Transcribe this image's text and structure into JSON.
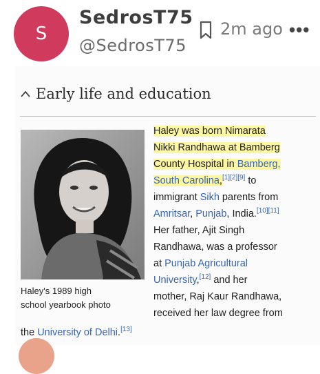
{
  "post": {
    "avatar_letter": "S",
    "username": "SedrosT75",
    "handle": "@SedrosT75",
    "time_ago": "2m ago",
    "more_label": "•••"
  },
  "colors": {
    "avatar": "#d03a5c",
    "link": "#3764b3",
    "highlight": "#fdf6a3"
  },
  "article": {
    "section_title": "Early life and education",
    "caption_line1": "Haley's 1989 high",
    "caption_line2": "school yearbook photo",
    "lines": [
      {
        "segs": [
          {
            "t": "Haley was born Nimarata",
            "c": "hl"
          }
        ]
      },
      {
        "segs": [
          {
            "t": "Nikki Randhawa at Bamberg",
            "c": "hl"
          }
        ]
      },
      {
        "segs": [
          {
            "t": "County Hospital in ",
            "c": "hl"
          },
          {
            "t": "Bamberg,",
            "c": "hl link"
          }
        ]
      },
      {
        "segs": [
          {
            "t": "South Carolina",
            "c": "hl link"
          },
          {
            "t": ",",
            "c": "hl"
          },
          {
            "t": "[1][2][9]",
            "c": "link sup"
          },
          {
            "t": " to",
            "c": ""
          }
        ]
      },
      {
        "segs": [
          {
            "t": "immigrant ",
            "c": ""
          },
          {
            "t": "Sikh",
            "c": "link"
          },
          {
            "t": " parents from",
            "c": ""
          }
        ]
      },
      {
        "segs": [
          {
            "t": "Amritsar",
            "c": "link"
          },
          {
            "t": ", ",
            "c": ""
          },
          {
            "t": "Punjab",
            "c": "link"
          },
          {
            "t": ", India.",
            "c": ""
          },
          {
            "t": "[10][11]",
            "c": "link sup"
          }
        ]
      },
      {
        "segs": [
          {
            "t": "Her father, Ajit Singh",
            "c": ""
          }
        ]
      },
      {
        "segs": [
          {
            "t": "Randhawa, was a professor",
            "c": ""
          }
        ]
      },
      {
        "segs": [
          {
            "t": "at ",
            "c": ""
          },
          {
            "t": "Punjab Agricultural",
            "c": "link"
          }
        ]
      },
      {
        "segs": [
          {
            "t": "University",
            "c": "link"
          },
          {
            "t": ",",
            "c": ""
          },
          {
            "t": "[12]",
            "c": "link sup"
          },
          {
            "t": " and her",
            "c": ""
          }
        ]
      },
      {
        "segs": [
          {
            "t": "mother, Raj Kaur Randhawa,",
            "c": ""
          }
        ]
      },
      {
        "segs": [
          {
            "t": "received her law degree from",
            "c": ""
          }
        ]
      }
    ],
    "last_line": [
      {
        "t": "the ",
        "c": ""
      },
      {
        "t": "University of Delhi",
        "c": "link"
      },
      {
        "t": ".",
        "c": ""
      },
      {
        "t": "[13]",
        "c": "link sup"
      }
    ]
  }
}
